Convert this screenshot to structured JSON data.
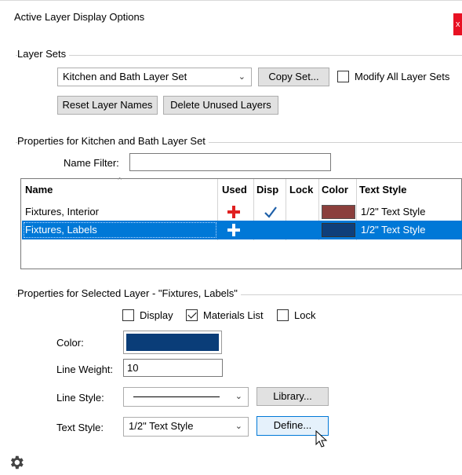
{
  "window": {
    "title": "Active Layer Display Options",
    "close_glyph": "x"
  },
  "layer_sets": {
    "group_label": "Layer Sets",
    "selected_set": "Kitchen and Bath Layer Set",
    "copy_set_label": "Copy Set...",
    "modify_all_label": "Modify All Layer Sets",
    "modify_all_checked": false,
    "reset_names_label": "Reset Layer Names",
    "delete_unused_label": "Delete Unused Layers"
  },
  "properties_set": {
    "group_label": "Properties for Kitchen and Bath Layer Set",
    "name_filter_label": "Name Filter:",
    "name_filter_value": ""
  },
  "table": {
    "columns": [
      "Name",
      "Used",
      "Disp",
      "Lock",
      "Color",
      "Text Style"
    ],
    "rows": [
      {
        "name": "Fixtures, Interior",
        "used": true,
        "disp": true,
        "lock": false,
        "color": "#8b3f3c",
        "text_style": "1/2\" Text Style",
        "selected": false
      },
      {
        "name": "Fixtures, Labels",
        "used": true,
        "disp": false,
        "lock": false,
        "color": "#0f3f7a",
        "text_style": "1/2\" Text Style",
        "selected": true
      }
    ]
  },
  "selected_layer": {
    "group_label": "Properties for Selected Layer - \"Fixtures, Labels\"",
    "display_label": "Display",
    "display_checked": false,
    "materials_label": "Materials List",
    "materials_checked": true,
    "lock_label": "Lock",
    "lock_checked": false,
    "color_label": "Color:",
    "color_value": "#0a3d78",
    "line_weight_label": "Line Weight:",
    "line_weight_value": "10",
    "line_style_label": "Line Style:",
    "library_label": "Library...",
    "text_style_label": "Text Style:",
    "text_style_value": "1/2\" Text Style",
    "define_label": "Define..."
  },
  "footer": {
    "icon": "gear-icon"
  },
  "colors": {
    "accent": "#0078d7",
    "used_plus": "#e02020",
    "disp_check": "#1d5fa8"
  }
}
